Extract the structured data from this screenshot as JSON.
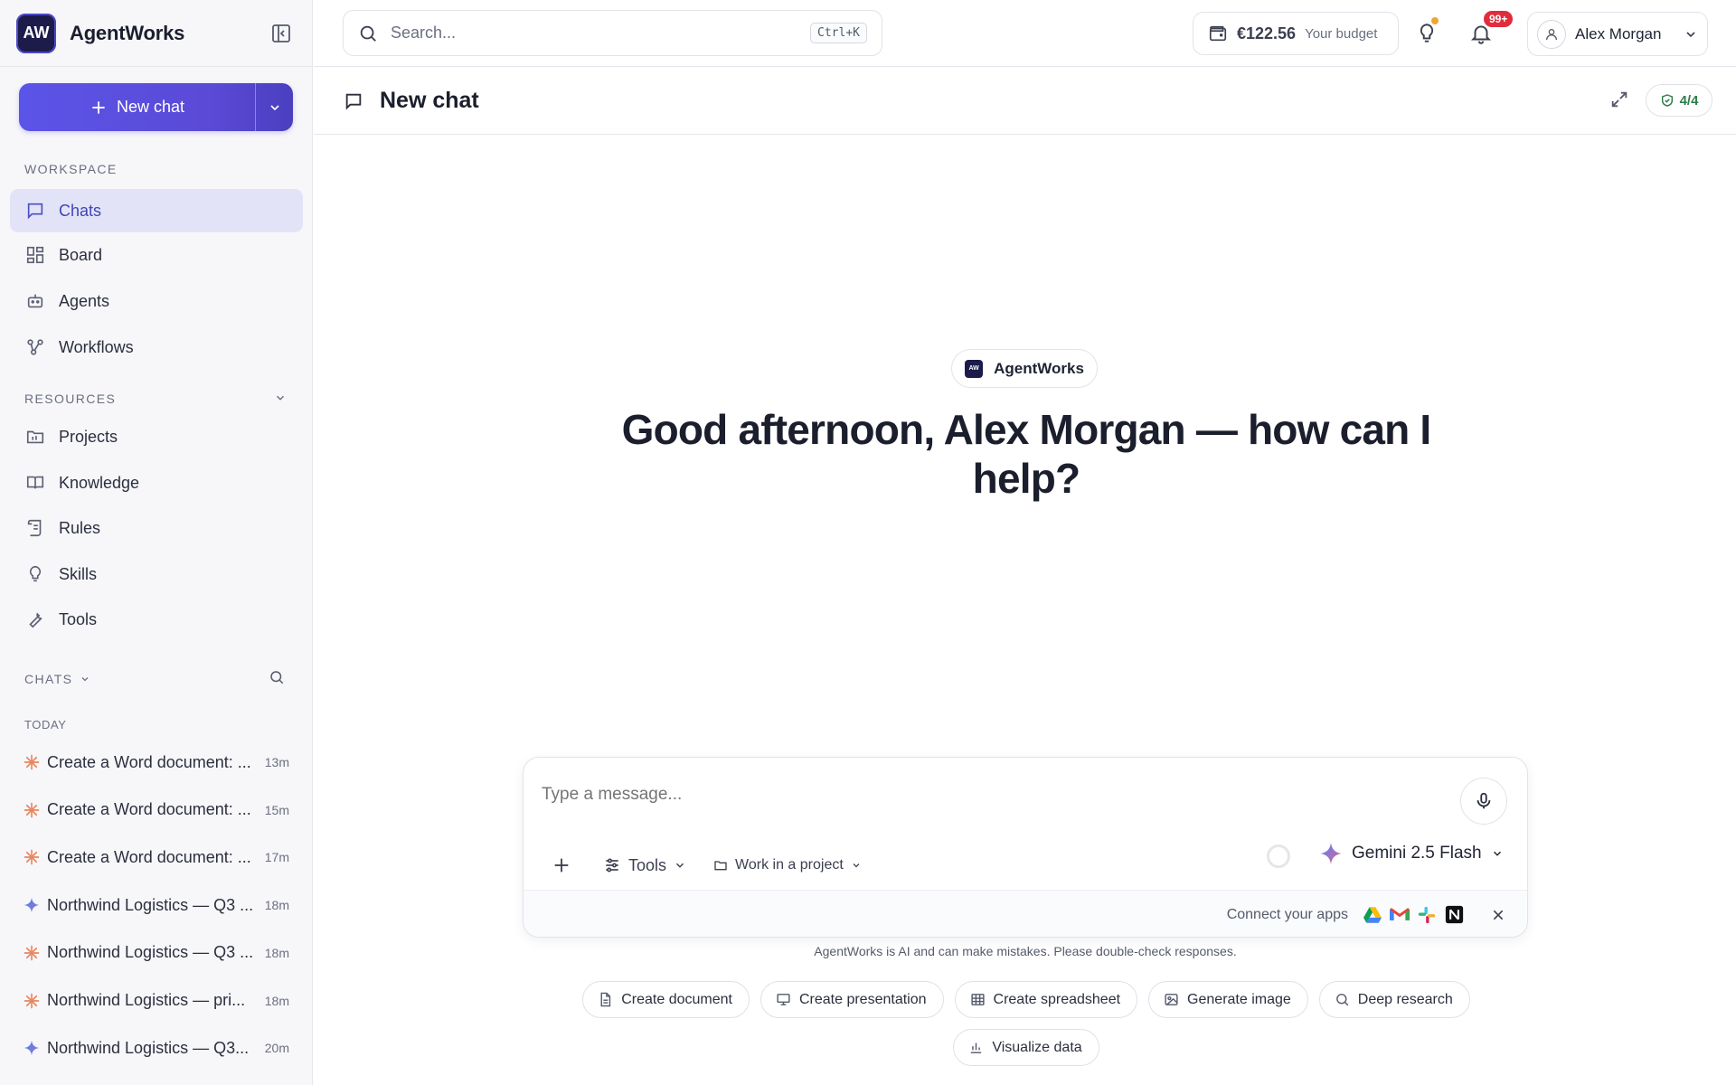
{
  "app": {
    "brand_initials": "AW",
    "brand_name": "AgentWorks"
  },
  "sidebar": {
    "new_chat_label": "New chat",
    "workspace_label": "WORKSPACE",
    "workspace_items": [
      {
        "label": "Chats",
        "icon": "chat-icon",
        "active": true
      },
      {
        "label": "Board",
        "icon": "board-icon"
      },
      {
        "label": "Agents",
        "icon": "robot-icon"
      },
      {
        "label": "Workflows",
        "icon": "workflow-icon"
      }
    ],
    "resources_label": "RESOURCES",
    "resource_items": [
      {
        "label": "Projects",
        "icon": "folder-icon"
      },
      {
        "label": "Knowledge",
        "icon": "book-icon"
      },
      {
        "label": "Rules",
        "icon": "scroll-icon"
      },
      {
        "label": "Skills",
        "icon": "bulb-icon"
      },
      {
        "label": "Tools",
        "icon": "wrench-icon"
      }
    ],
    "chats_label": "CHATS",
    "today_label": "TODAY",
    "chats": [
      {
        "title": "Create a Word document: ...",
        "time": "13m",
        "icon": "sparkle-orange-icon"
      },
      {
        "title": "Create a Word document: ...",
        "time": "15m",
        "icon": "sparkle-orange-icon"
      },
      {
        "title": "Create a Word document: ...",
        "time": "17m",
        "icon": "sparkle-orange-icon"
      },
      {
        "title": "Northwind Logistics — Q3 ...",
        "time": "18m",
        "icon": "sparkle-blue-icon"
      },
      {
        "title": "Northwind Logistics — Q3 ...",
        "time": "18m",
        "icon": "sparkle-orange-icon"
      },
      {
        "title": "Northwind Logistics — pri...",
        "time": "18m",
        "icon": "sparkle-orange-icon"
      },
      {
        "title": "Northwind Logistics — Q3...",
        "time": "20m",
        "icon": "sparkle-blue-icon"
      }
    ]
  },
  "topbar": {
    "search_placeholder": "Search...",
    "search_shortcut": "Ctrl+K",
    "budget_amount": "€122.56",
    "budget_label": "Your budget",
    "notifications_badge": "99+",
    "user_name": "Alex Morgan"
  },
  "chat_header": {
    "title": "New chat",
    "guard_status": "4/4"
  },
  "hero": {
    "chip_label": "AgentWorks",
    "greeting": "Good afternoon, Alex Morgan — how can I help?"
  },
  "composer": {
    "placeholder": "Type a message...",
    "tools_label": "Tools",
    "project_label": "Work in a project",
    "model_name": "Gemini 2.5 Flash",
    "connect_label": "Connect your apps"
  },
  "disclaimer": "AgentWorks is AI and can make mistakes. Please double-check responses.",
  "actions": [
    {
      "label": "Create document",
      "icon": "document-icon"
    },
    {
      "label": "Create presentation",
      "icon": "presentation-icon"
    },
    {
      "label": "Create spreadsheet",
      "icon": "table-icon"
    },
    {
      "label": "Generate image",
      "icon": "image-icon"
    },
    {
      "label": "Deep research",
      "icon": "search-icon"
    },
    {
      "label": "Visualize data",
      "icon": "bar-chart-icon"
    }
  ],
  "colors": {
    "accent": "#5b54e8",
    "brand_dark": "#1c1b4a",
    "badge_red": "#e02d3c",
    "guard_green": "#2f7d4a"
  }
}
